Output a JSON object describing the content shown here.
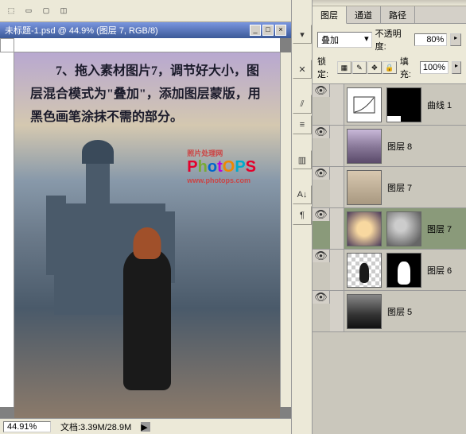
{
  "document": {
    "title": "未标题-1.psd @ 44.9% (图层 7, RGB/8)",
    "zoom": "44.91%",
    "file_info": "文档:3.39M/28.9M"
  },
  "canvas": {
    "instruction_text": "　　7、拖入素材图片7，调节好大小，图层混合模式为\"叠加\"，添加图层蒙版，用黑色画笔涂抹不需的部分。",
    "logo_prefix": "照片处理网",
    "logo_url": "www.photops.com"
  },
  "panels": {
    "tabs": [
      "图层",
      "通道",
      "路径"
    ],
    "active_tab": "图层",
    "blend_mode_label": "",
    "blend_mode": "叠加",
    "opacity_label": "不透明度:",
    "opacity": "80%",
    "lock_label": "锁定:",
    "fill_label": "填充:",
    "fill": "100%"
  },
  "layers": [
    {
      "name": "曲线 1",
      "type": "curves",
      "visible": true,
      "mask": "white-bottom"
    },
    {
      "name": "图层 8",
      "type": "img1",
      "visible": true
    },
    {
      "name": "图层 7",
      "type": "img2",
      "visible": true
    },
    {
      "name": "图层 7",
      "type": "img3",
      "visible": true,
      "mask": "img4",
      "selected": true
    },
    {
      "name": "图层 6",
      "type": "checker-fig",
      "visible": true,
      "mask": "mask-fig"
    },
    {
      "name": "图层 5",
      "type": "img6",
      "visible": true
    }
  ]
}
